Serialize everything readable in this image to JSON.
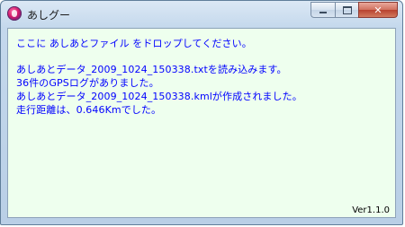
{
  "window": {
    "title": "あしグー",
    "caption_buttons": {
      "minimize_icon": "minimize-icon",
      "maximize_icon": "maximize-icon",
      "close_glyph": "✕"
    }
  },
  "content": {
    "instruction": "ここに あしあとファイル をドロップしてください。",
    "log": [
      "あしあとデータ_2009_1024_150338.txtを読み込みます。",
      "36件のGPSログがありました。",
      "あしあとデータ_2009_1024_150338.kmlが作成されました。",
      "走行距離は、0.646Kmでした。"
    ],
    "version": "Ver1.1.0"
  },
  "colors": {
    "text": "#0000ff",
    "client_background": "#eeffee"
  }
}
